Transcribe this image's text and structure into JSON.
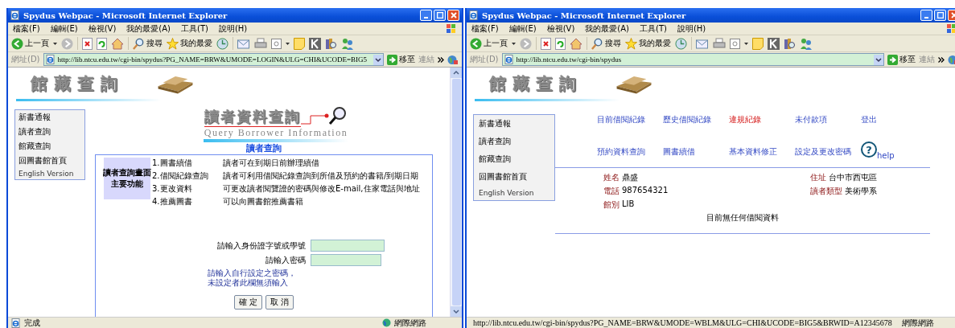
{
  "windows": [
    {
      "title": "Spydus Webpac - Microsoft Internet Explorer",
      "kind": "login",
      "menu": [
        "檔案(F)",
        "編輯(E)",
        "檢視(V)",
        "我的最愛(A)",
        "工具(T)",
        "說明(H)"
      ],
      "toolbar": {
        "back": "上一頁",
        "search": "搜尋",
        "favorites": "我的最愛"
      },
      "address": {
        "label": "網址(D)",
        "url": "http://lib.ntcu.edu.tw/cgi-bin/spydus?PG_NAME=BRW&UMODE=LOGIN&ULG=CHI&UCODE=BIG5",
        "go": "移至",
        "links": "連結"
      },
      "banner": "館藏查詢",
      "nav": [
        "新書通報",
        "讀者查詢",
        "館藏查詢",
        "回圖書館首頁",
        "English Version"
      ],
      "header": {
        "title": "讀者資料查詢",
        "subtitle": "Query Borrower Information",
        "heading": "讀者查詢"
      },
      "functions": {
        "label_lines": [
          "讀者查詢畫面",
          "主要功能"
        ],
        "rows": [
          {
            "name": "1.圖書續借",
            "desc": "讀者可在到期日前辦理續借"
          },
          {
            "name": "2.借閱紀錄查詢",
            "desc": "讀者可利用借閱紀錄查詢到所借及預約的書籍/到期日期"
          },
          {
            "name": "3.更改資料",
            "desc": "可更改讀者閱覽證的密碼與修改E-mail,住家電話與地址"
          },
          {
            "name": "4.推薦圖書",
            "desc": "可以向圖書館推薦書籍"
          }
        ]
      },
      "form": {
        "fields": [
          {
            "label": "請輸入身份證字號或學號"
          },
          {
            "label": "請輸入密碼"
          }
        ],
        "note": "請輸入自行設定之密碼，未設定者此欄無須輸入",
        "buttons": [
          "確 定",
          "取 消"
        ]
      },
      "status": {
        "text": "完成",
        "zone": "網際網路"
      }
    },
    {
      "title": "Spydus Webpac - Microsoft Internet Explorer",
      "kind": "account",
      "menu": [
        "檔案(F)",
        "編輯(E)",
        "檢視(V)",
        "我的最愛(A)",
        "工具(T)",
        "說明(H)"
      ],
      "toolbar": {
        "back": "上一頁",
        "search": "搜尋",
        "favorites": "我的最愛"
      },
      "address": {
        "label": "網址(D)",
        "url": "http://lib.ntcu.edu.tw/cgi-bin/spydus",
        "go": "移至",
        "links": "連結"
      },
      "banner": "館藏查詢",
      "nav": [
        "新書通報",
        "讀者查詢",
        "館藏查詢",
        "回圖書館首頁",
        "English Version"
      ],
      "links": [
        {
          "label": "目前借閱紀錄",
          "selected": false
        },
        {
          "label": "歷史借閱紀錄",
          "selected": false
        },
        {
          "label": "違規紀錄",
          "selected": true
        },
        {
          "label": "未付款項",
          "selected": false
        },
        {
          "label": "登出",
          "selected": false
        },
        {
          "label": "預約資料查詢",
          "selected": false
        },
        {
          "label": "圖書續借",
          "selected": false
        },
        {
          "label": "基本資料修正",
          "selected": false
        },
        {
          "label": "設定及更改密碼",
          "selected": false
        }
      ],
      "help": "help",
      "help_icon": "?",
      "info": [
        {
          "label": "姓名",
          "value": "鼎盛"
        },
        {
          "label": "住址",
          "value": "台中市西屯區"
        },
        {
          "label": "電話",
          "value": "987654321"
        },
        {
          "label": "讀者類型",
          "value": "美術學系"
        },
        {
          "label": "館別",
          "value": "LIB"
        }
      ],
      "message": "目前無任何借閱資料",
      "status": {
        "text": "http://lib.ntcu.edu.tw/cgi-bin/spydus?PG_NAME=BRW&UMODE=WBLM&ULG=CHI&UCODE=BIG5&BRWID=A12345678",
        "zone": "網際網路"
      }
    }
  ]
}
